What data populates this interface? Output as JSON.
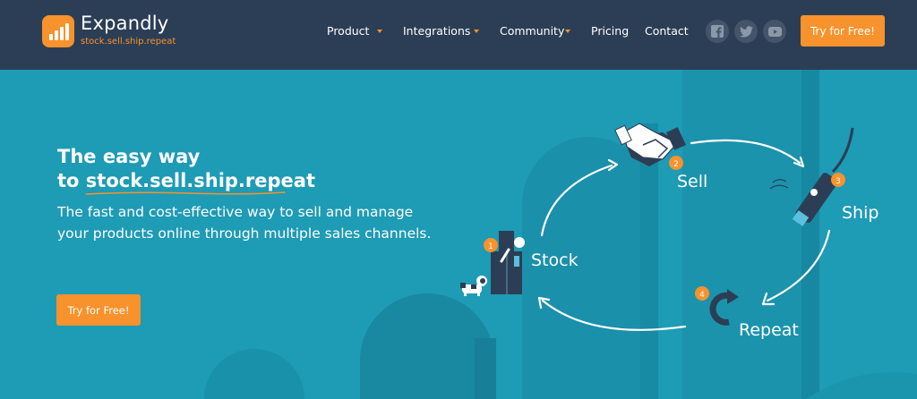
{
  "brand": {
    "name": "Expandly",
    "tagline": "stock.sell.ship.repeat",
    "accent_color": "#f7922c",
    "nav_bg_color": "#2c3e55",
    "hero_bg_color": "#1e9bb5"
  },
  "nav": {
    "items": [
      {
        "label": "Product",
        "dropdown": true
      },
      {
        "label": "Integrations",
        "dropdown": true
      },
      {
        "label": "Community",
        "dropdown": true
      },
      {
        "label": "Pricing",
        "dropdown": false
      },
      {
        "label": "Contact",
        "dropdown": false
      }
    ],
    "social_icons": [
      "facebook-icon",
      "twitter-icon",
      "youtube-icon"
    ],
    "cta_label": "Try for Free!"
  },
  "hero": {
    "headline_line1": "The easy way",
    "headline_prefix": "to ",
    "headline_highlight": "stock.sell.ship.repeat",
    "subtext": "The fast and cost-effective way to sell and manage your products online through multiple sales channels.",
    "cta_label": "Try for Free!"
  },
  "cycle": {
    "steps": [
      {
        "number": "1",
        "label": "Stock",
        "icon": "boxes-icon"
      },
      {
        "number": "2",
        "label": "Sell",
        "icon": "handshake-icon"
      },
      {
        "number": "3",
        "label": "Ship",
        "icon": "scanner-icon"
      },
      {
        "number": "4",
        "label": "Repeat",
        "icon": "refresh-icon"
      }
    ]
  }
}
